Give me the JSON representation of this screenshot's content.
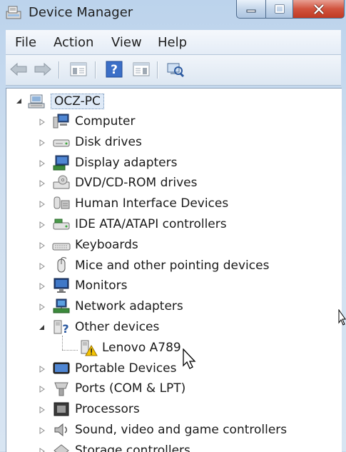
{
  "window": {
    "title": "Device Manager",
    "icon": "device-manager-icon"
  },
  "menu": {
    "file": "File",
    "action": "Action",
    "view": "View",
    "help": "Help"
  },
  "toolbar": [
    "back-arrow-icon",
    "forward-arrow-icon",
    "properties-pane-icon",
    "help-icon",
    "action-pane-icon",
    "scan-hardware-icon"
  ],
  "tree": {
    "root": "OCZ-PC",
    "items": [
      {
        "label": "Computer",
        "icon": "computer-icon"
      },
      {
        "label": "Disk drives",
        "icon": "disk-drive-icon"
      },
      {
        "label": "Display adapters",
        "icon": "display-adapter-icon"
      },
      {
        "label": "DVD/CD-ROM drives",
        "icon": "dvd-drive-icon"
      },
      {
        "label": "Human Interface Devices",
        "icon": "hid-icon"
      },
      {
        "label": "IDE ATA/ATAPI controllers",
        "icon": "ide-controller-icon"
      },
      {
        "label": "Keyboards",
        "icon": "keyboard-icon"
      },
      {
        "label": "Mice and other pointing devices",
        "icon": "mouse-icon"
      },
      {
        "label": "Monitors",
        "icon": "monitor-icon"
      },
      {
        "label": "Network adapters",
        "icon": "network-adapter-icon"
      },
      {
        "label": "Other devices",
        "icon": "other-devices-icon",
        "expanded": true
      },
      {
        "label": "Lenovo A789",
        "icon": "warning-device-icon",
        "child": true
      },
      {
        "label": "Portable Devices",
        "icon": "portable-device-icon"
      },
      {
        "label": "Ports (COM & LPT)",
        "icon": "port-icon"
      },
      {
        "label": "Processors",
        "icon": "processor-icon"
      },
      {
        "label": "Sound, video and game controllers",
        "icon": "sound-icon"
      },
      {
        "label": "Storage controllers",
        "icon": "storage-controller-icon"
      }
    ]
  }
}
